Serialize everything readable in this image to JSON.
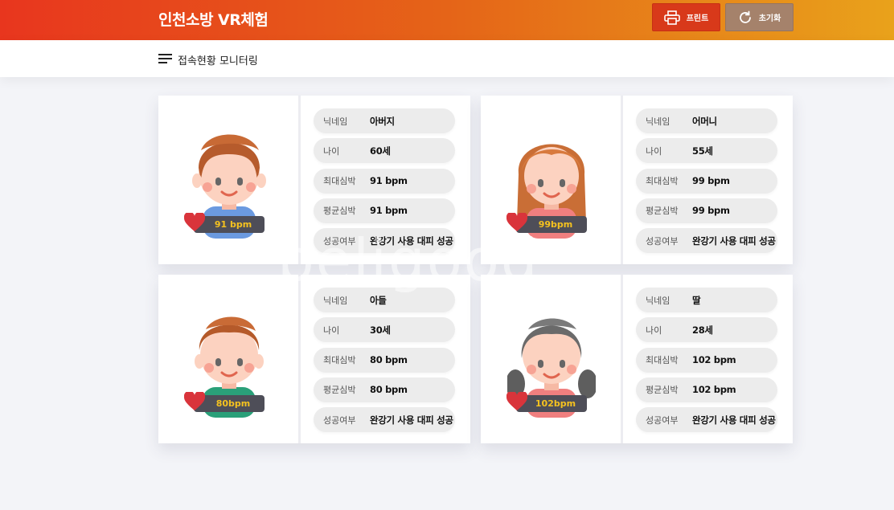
{
  "app": {
    "title": "인천소방 VR체험",
    "print_label": "프린트",
    "reset_label": "초기화",
    "subtitle": "접속현황 모니터링",
    "accent": "#e8361e"
  },
  "cards": [
    {
      "bpm_label": "91 bpm",
      "avatar": "boy-avatar",
      "rows": [
        {
          "label": "닉네임",
          "value": "아버지"
        },
        {
          "label": "나이",
          "value": "60세"
        },
        {
          "label": "최대심박",
          "value": "91 bpm"
        },
        {
          "label": "평균심박",
          "value": "91 bpm"
        },
        {
          "label": "성공여부",
          "value": "완강기 사용 대피 성공"
        }
      ]
    },
    {
      "bpm_label": "99bpm",
      "avatar": "woman-avatar",
      "rows": [
        {
          "label": "닉네임",
          "value": "어머니"
        },
        {
          "label": "나이",
          "value": "55세"
        },
        {
          "label": "최대심박",
          "value": "99 bpm"
        },
        {
          "label": "평균심박",
          "value": "99 bpm"
        },
        {
          "label": "성공여부",
          "value": "완강기 사용 대피 성공"
        }
      ]
    },
    {
      "bpm_label": "80bpm",
      "avatar": "boy2-avatar",
      "rows": [
        {
          "label": "닉네임",
          "value": "아들"
        },
        {
          "label": "나이",
          "value": "30세"
        },
        {
          "label": "최대심박",
          "value": "80 bpm"
        },
        {
          "label": "평균심박",
          "value": "80 bpm"
        },
        {
          "label": "성공여부",
          "value": "완강기 사용 대피 성공"
        }
      ]
    },
    {
      "bpm_label": "102bpm",
      "avatar": "girl-avatar",
      "rows": [
        {
          "label": "닉네임",
          "value": "딸"
        },
        {
          "label": "나이",
          "value": "28세"
        },
        {
          "label": "최대심박",
          "value": "102 bpm"
        },
        {
          "label": "평균심박",
          "value": "102 bpm"
        },
        {
          "label": "성공여부",
          "value": "완강기 사용 대피 성공"
        }
      ]
    }
  ],
  "watermark": "peligood"
}
